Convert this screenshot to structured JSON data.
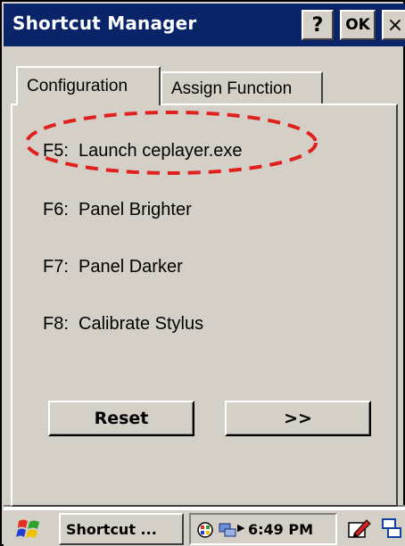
{
  "window": {
    "title": "Shortcut Manager",
    "help_label": "?",
    "ok_label": "OK",
    "close_label": "×"
  },
  "tabs": [
    {
      "label": "Configuration",
      "active": true
    },
    {
      "label": "Assign Function",
      "active": false
    }
  ],
  "shortcuts": [
    {
      "key": "F5:",
      "action": "Launch ceplayer.exe"
    },
    {
      "key": "F6:",
      "action": "Panel Brighter"
    },
    {
      "key": "F7:",
      "action": "Panel Darker"
    },
    {
      "key": "F8:",
      "action": "Calibrate Stylus"
    }
  ],
  "buttons": {
    "reset_label": "Reset",
    "next_label": ">>"
  },
  "taskbar": {
    "task_label": "Shortcut ...",
    "clock": "6:49 PM",
    "icons": [
      "windows-start-icon",
      "network-icon",
      "connection-icon",
      "sip-keyboard-icon",
      "desktop-icon"
    ]
  },
  "colors": {
    "titlebar": "#0a246a",
    "face": "#d4d0c8",
    "annotation": "#e0201c"
  }
}
